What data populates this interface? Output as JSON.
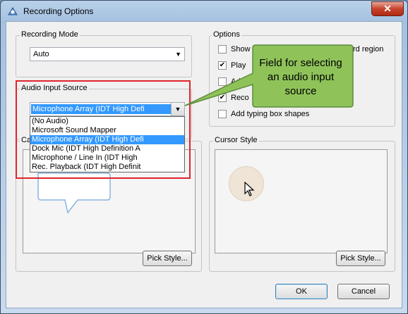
{
  "window": {
    "title": "Recording Options",
    "close_glyph": "✕"
  },
  "recording_mode": {
    "label": "Recording Mode",
    "value": "Auto"
  },
  "audio": {
    "label": "Audio Input Source",
    "value": "Microphone Array (IDT High Defi",
    "options": [
      "(No Audio)",
      "Microsoft Sound Mapper",
      "Microphone Array (IDT High Defi",
      "Dock Mic (IDT High Definition A",
      "Microphone / Line In (IDT High",
      "Rec. Playback (IDT High Definit"
    ],
    "selected_index": 2
  },
  "options": {
    "label": "Options",
    "items": [
      {
        "label": "Show",
        "tail": "rd region",
        "checked": false
      },
      {
        "label": "Play",
        "checked": true
      },
      {
        "label": "Add c",
        "checked": false
      },
      {
        "label": "Reco",
        "checked": true
      },
      {
        "label": "Add typing box shapes",
        "checked": false
      }
    ]
  },
  "callout_style": {
    "label": "Ca",
    "pick_label": "Pick Style..."
  },
  "cursor_style": {
    "label": "Cursor Style",
    "pick_label": "Pick Style..."
  },
  "buttons": {
    "ok": "OK",
    "cancel": "Cancel"
  },
  "annotation": {
    "text": "Field for selecting an audio input source",
    "color": "#8fc35a"
  },
  "colors": {
    "highlight": "#e0242c",
    "selection": "#3399ff"
  }
}
